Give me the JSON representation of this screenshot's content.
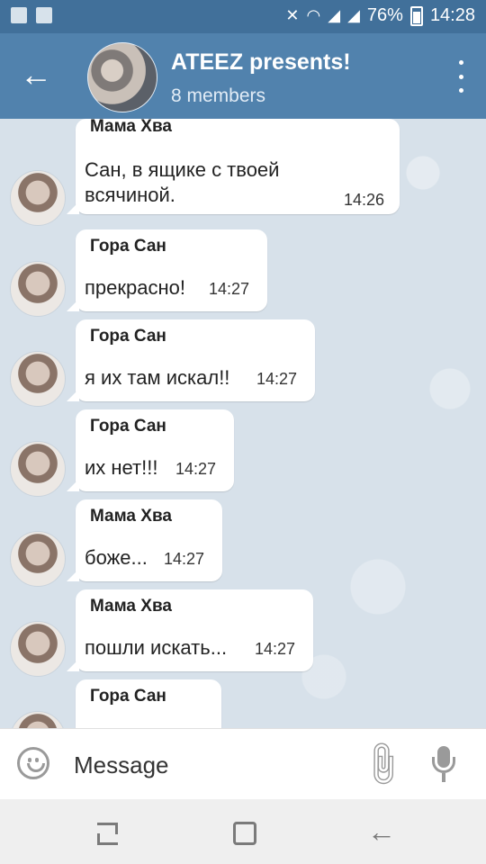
{
  "status_bar": {
    "battery": "76%",
    "time": "14:28"
  },
  "header": {
    "title": "ATEEZ presents!",
    "subtitle": "8 members"
  },
  "messages": [
    {
      "sender": "Мама Хва",
      "text": "Сан, в ящике с твоей\nвсячиной.",
      "time": "14:26"
    },
    {
      "sender": "Гора Сан",
      "text": "прекрасно!",
      "time": "14:27"
    },
    {
      "sender": "Гора Сан",
      "text": "я их там искал!!",
      "time": "14:27"
    },
    {
      "sender": "Гора Сан",
      "text": "их нет!!!",
      "time": "14:27"
    },
    {
      "sender": "Мама Хва",
      "text": "боже...",
      "time": "14:27"
    },
    {
      "sender": "Мама Хва",
      "text": "пошли искать...",
      "time": "14:27"
    },
    {
      "sender": "Гора Сан",
      "text": "",
      "time": ""
    }
  ],
  "input": {
    "placeholder": "Message"
  },
  "icons": {
    "back": "arrow-left-icon",
    "menu": "more-vertical-icon",
    "emoji": "emoji-icon",
    "attach": "paperclip-icon",
    "mic": "microphone-icon"
  },
  "colors": {
    "header": "#5182ad",
    "status_bar": "#41709a",
    "chat_bg": "#d7e1ea",
    "bubble": "#ffffff"
  }
}
